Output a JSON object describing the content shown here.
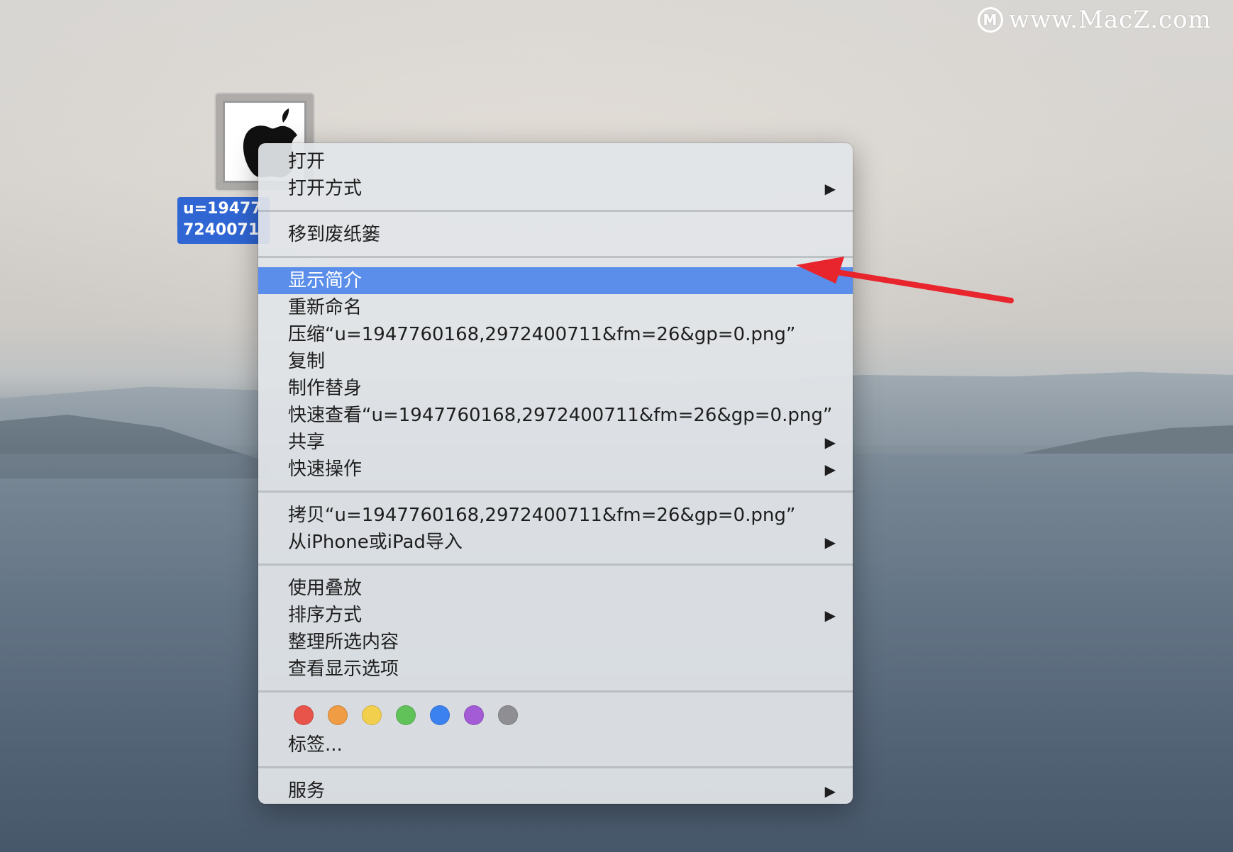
{
  "watermark": {
    "logo_glyph": "M",
    "text": "www.MacZ.com"
  },
  "desktop_file": {
    "label_line1": "u=19477",
    "label_line2": "7240071",
    "icon": "apple-logo-icon"
  },
  "menu": {
    "group1": [
      {
        "label": "打开",
        "submenu": false
      },
      {
        "label": "打开方式",
        "submenu": true
      }
    ],
    "group2": [
      {
        "label": "移到废纸篓",
        "submenu": false
      }
    ],
    "group3": [
      {
        "label": "显示简介",
        "submenu": false,
        "highlighted": true
      },
      {
        "label": "重新命名",
        "submenu": false
      },
      {
        "label": "压缩“u=1947760168,2972400711&fm=26&gp=0.png”",
        "submenu": false
      },
      {
        "label": "复制",
        "submenu": false
      },
      {
        "label": "制作替身",
        "submenu": false
      },
      {
        "label": "快速查看“u=1947760168,2972400711&fm=26&gp=0.png”",
        "submenu": false
      },
      {
        "label": "共享",
        "submenu": true
      },
      {
        "label": "快速操作",
        "submenu": true
      }
    ],
    "group4": [
      {
        "label": "拷贝“u=1947760168,2972400711&fm=26&gp=0.png”",
        "submenu": false
      },
      {
        "label": "从iPhone或iPad导入",
        "submenu": true
      }
    ],
    "group5": [
      {
        "label": "使用叠放",
        "submenu": false
      },
      {
        "label": "排序方式",
        "submenu": true
      },
      {
        "label": "整理所选内容",
        "submenu": false
      },
      {
        "label": "查看显示选项",
        "submenu": false
      }
    ],
    "tag_colors": [
      "#e8534a",
      "#ef9c45",
      "#f3cf4e",
      "#62c25a",
      "#3b82f0",
      "#a45bd6",
      "#8e8e93"
    ],
    "tags_label": "标签...",
    "group6": [
      {
        "label": "服务",
        "submenu": true
      }
    ],
    "submenu_glyph": "▶"
  },
  "colors": {
    "highlight": "#5a8eea",
    "selection_label": "#2f66d4",
    "annotation_arrow": "#e8242c"
  }
}
